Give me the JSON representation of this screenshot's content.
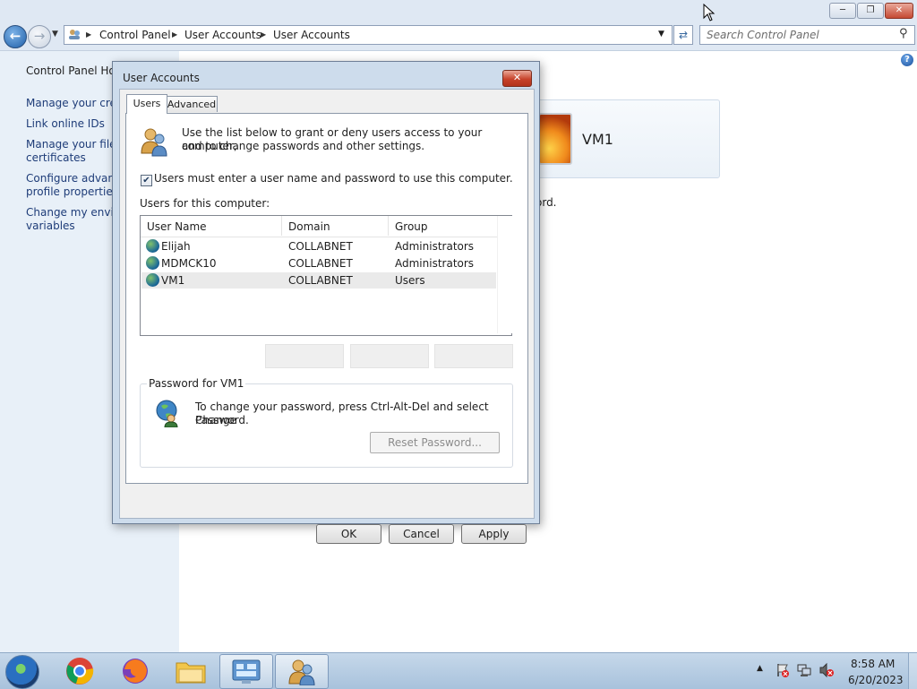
{
  "window": {
    "breadcrumbs": [
      "Control Panel",
      "User Accounts",
      "User Accounts"
    ],
    "search_placeholder": "Search Control Panel"
  },
  "left_panel": {
    "home": "Control Panel Hor",
    "links": [
      {
        "line1": "Manage your cred",
        "line2": ""
      },
      {
        "line1": "Link online IDs",
        "line2": ""
      },
      {
        "line1": "Manage your file e",
        "line2": "certificates"
      },
      {
        "line1": "Configure advanc",
        "line2": "profile properties"
      },
      {
        "line1": "Change my enviro",
        "line2": "variables"
      }
    ]
  },
  "main": {
    "account_name": "VM1",
    "partial_text": "ord."
  },
  "dialog": {
    "title": "User Accounts",
    "tabs": [
      "Users",
      "Advanced"
    ],
    "intro_line1": "Use the list below to grant or deny users access to your computer,",
    "intro_line2": "and to change passwords and other settings.",
    "checkbox_label": "Users must enter a user name and password to use this computer.",
    "checkbox_checked": true,
    "users_label": "Users for this computer:",
    "columns": [
      "User Name",
      "Domain",
      "Group"
    ],
    "rows": [
      {
        "name": "Elijah",
        "domain": "COLLABNET",
        "group": "Administrators"
      },
      {
        "name": "MDMCK10",
        "domain": "COLLABNET",
        "group": "Administrators"
      },
      {
        "name": "VM1",
        "domain": "COLLABNET",
        "group": "Users"
      }
    ],
    "selected_row": 2,
    "password_group_title": "Password for VM1",
    "password_line1": "To change your password, press Ctrl-Alt-Del and select Change",
    "password_line2": "Password.",
    "reset_button": "Reset Password...",
    "ok": "OK",
    "cancel": "Cancel",
    "apply": "Apply"
  },
  "taskbar": {
    "time": "8:58 AM",
    "date": "6/20/2023",
    "apps": [
      "chrome-icon",
      "firefox-icon",
      "file-explorer-icon",
      "control-panel-icon",
      "user-accounts-icon"
    ]
  }
}
